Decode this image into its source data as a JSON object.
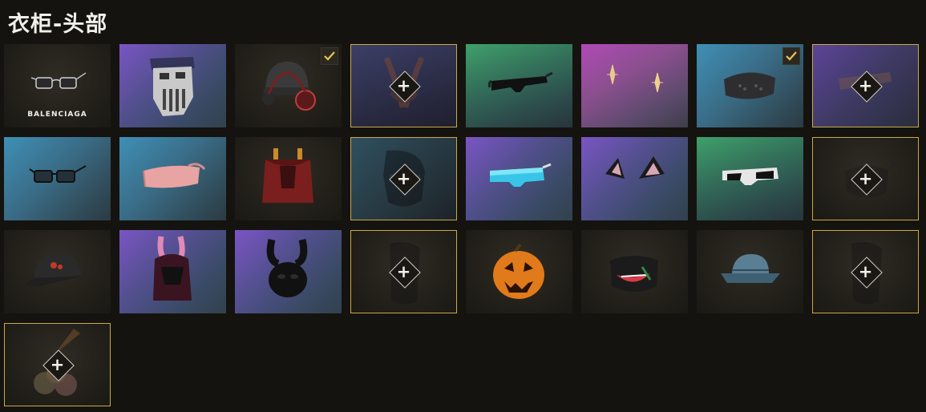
{
  "page": {
    "title": "衣柜-头部"
  },
  "colors": {
    "background": "#15130f",
    "locked_border": "#c9a944",
    "check": "#e7c54f"
  },
  "items": [
    {
      "name": "balenciaga-glasses",
      "bg": "dark",
      "brand_label": "BALENCIAGA"
    },
    {
      "name": "skull-mask-bandana",
      "bg": "purple"
    },
    {
      "name": "beanie-headphones",
      "bg": "dark",
      "equipped": true
    },
    {
      "name": "bunny-ears-brown",
      "bg": "navy",
      "locked": true
    },
    {
      "name": "black-sunglasses",
      "bg": "green"
    },
    {
      "name": "star-earrings",
      "bg": "pink"
    },
    {
      "name": "blindfold-mask",
      "bg": "blue",
      "equipped": true
    },
    {
      "name": "leather-eyepatch",
      "bg": "purpledark",
      "locked": true
    },
    {
      "name": "thin-glasses",
      "bg": "blue"
    },
    {
      "name": "pink-sleep-mask",
      "bg": "blue"
    },
    {
      "name": "red-hood-pigtails",
      "bg": "dark"
    },
    {
      "name": "black-helmet-mask",
      "bg": "teal",
      "locked": true
    },
    {
      "name": "mirrored-sport-glasses",
      "bg": "purple"
    },
    {
      "name": "cat-ears",
      "bg": "purple"
    },
    {
      "name": "white-sunglasses",
      "bg": "green"
    },
    {
      "name": "black-face-mask",
      "bg": "dark",
      "locked": true
    },
    {
      "name": "black-cap",
      "bg": "dark"
    },
    {
      "name": "bunny-hood-pink",
      "bg": "purple"
    },
    {
      "name": "black-bunny-mask",
      "bg": "purple"
    },
    {
      "name": "black-bandana-mask",
      "bg": "dark",
      "locked": true
    },
    {
      "name": "pumpkin-head",
      "bg": "dark"
    },
    {
      "name": "grin-face-mask",
      "bg": "dark"
    },
    {
      "name": "denim-bucket-hat",
      "bg": "dark"
    },
    {
      "name": "black-bandana-mask-2",
      "bg": "dark",
      "locked": true
    },
    {
      "name": "ice-cream-cone-hat",
      "bg": "dark",
      "locked": true
    }
  ]
}
